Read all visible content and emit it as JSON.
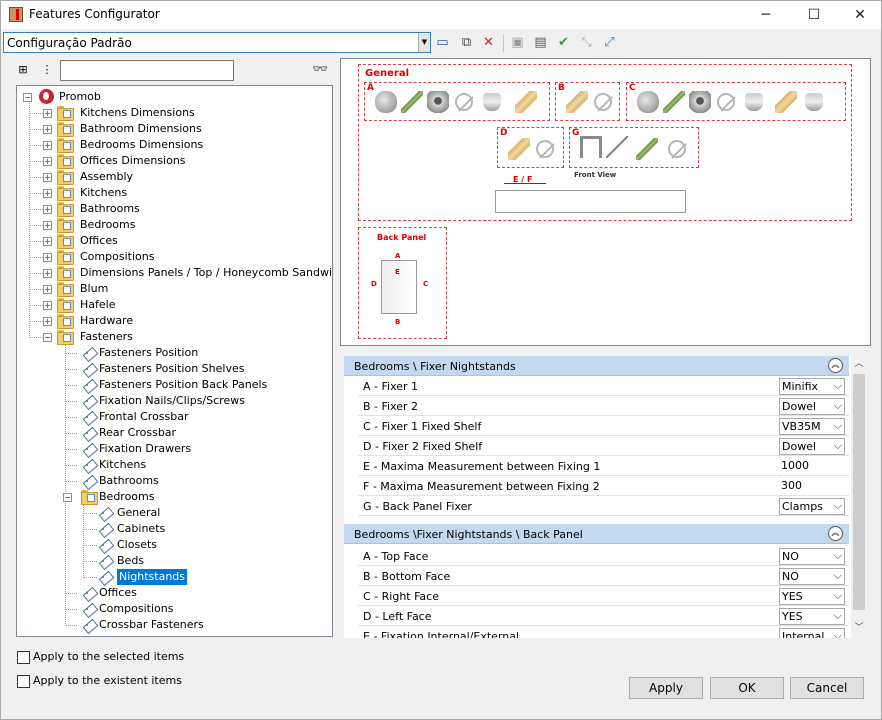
{
  "window": {
    "title": "Features Configurator",
    "minimize": "─",
    "maximize": "☐",
    "close": "✕"
  },
  "combo": {
    "value": "Configuração Padrão"
  },
  "tree": {
    "search_placeholder": "",
    "root": "Promob",
    "top_items": [
      "Kitchens Dimensions",
      "Bathroom Dimensions",
      "Bedrooms Dimensions",
      "Offices Dimensions",
      "Assembly",
      "Kitchens",
      "Bathrooms",
      "Bedrooms",
      "Offices",
      "Compositions",
      "Dimensions Panels / Top / Honeycomb Sandwich",
      "Blum",
      "Hafele",
      "Hardware",
      "Fasteners"
    ],
    "fastener_items": [
      "Fasteners Position",
      "Fasteners Position Shelves",
      "Fasteners Position Back Panels",
      "Fixation Nails/Clips/Screws",
      "Frontal Crossbar",
      "Rear Crossbar",
      "Fixation Drawers",
      "Kitchens",
      "Bathrooms",
      "Bedrooms"
    ],
    "bedroom_items": [
      "General",
      "Cabinets",
      "Closets",
      "Beds",
      "Nightstands"
    ],
    "after_items": [
      "Offices",
      "Compositions",
      "Crossbar Fasteners"
    ]
  },
  "preview": {
    "general_label": "General",
    "box_letters": [
      "A",
      "B",
      "C",
      "D",
      "G"
    ],
    "ef_label": "E / F",
    "front_view": "Front View",
    "back_panel_label": "Back Panel",
    "back_letters": [
      "A",
      "B",
      "C",
      "D",
      "E"
    ]
  },
  "grid": {
    "section1": "Bedrooms \\ Fixer Nightstands",
    "rows1": [
      {
        "label": "A - Fixer 1",
        "value": "Minifix",
        "dropdown": true
      },
      {
        "label": "B - Fixer 2",
        "value": "Dowel",
        "dropdown": true
      },
      {
        "label": "C - Fixer 1 Fixed Shelf",
        "value": "VB35M",
        "dropdown": true
      },
      {
        "label": "D - Fixer 2 Fixed Shelf",
        "value": "Dowel",
        "dropdown": true
      },
      {
        "label": "E - Maxima Measurement between Fixing 1",
        "value": "1000",
        "dropdown": false
      },
      {
        "label": "F - Maxima Measurement between Fixing 2",
        "value": "300",
        "dropdown": false
      },
      {
        "label": "G - Back Panel Fixer",
        "value": "Clamps",
        "dropdown": true
      }
    ],
    "section2": "Bedrooms \\Fixer Nightstands \\ Back Panel",
    "rows2": [
      {
        "label": "A - Top Face",
        "value": "NO",
        "dropdown": true
      },
      {
        "label": "B - Bottom Face",
        "value": "NO",
        "dropdown": true
      },
      {
        "label": "C - Right Face",
        "value": "YES",
        "dropdown": true
      },
      {
        "label": "D - Left Face",
        "value": "YES",
        "dropdown": true
      },
      {
        "label": "E - Fixation Internal/External",
        "value": "Internal",
        "dropdown": true
      }
    ]
  },
  "options": {
    "apply_selected": "Apply to the selected items",
    "apply_existent": "Apply to the existent items"
  },
  "buttons": {
    "apply": "Apply",
    "ok": "OK",
    "cancel": "Cancel"
  }
}
